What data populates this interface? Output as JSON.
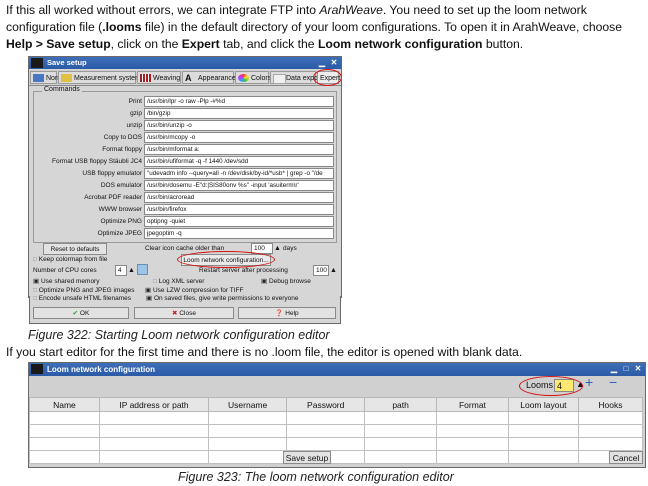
{
  "intro": {
    "p1_a": "If this all worked without errors, we can integrate FTP into ",
    "p1_app": "ArahWeave",
    "p1_b": ". You need to set up the loom network configuration file (",
    "p1_ext": ".looms",
    "p1_c": " file) in the default directory of your loom configurations. To open it in ArahWeave, choose ",
    "p1_menu": "Help > Save setup",
    "p1_d": ", click on the ",
    "p1_tab": "Expert",
    "p1_e": " tab, and click the ",
    "p1_btn": "Loom network configuration",
    "p1_f": " button."
  },
  "save_setup": {
    "title": "Save setup",
    "tabs": [
      "Normal",
      "Measurement system",
      "Weaving",
      "Appearance",
      "Colors",
      "Data export",
      "Expert"
    ],
    "commands_title": "Commands",
    "commands": [
      {
        "label": "Print",
        "value": "/usr/bin/lpr -o raw -Plp -#%d"
      },
      {
        "label": "gzip",
        "value": "/bin/gzip"
      },
      {
        "label": "unzip",
        "value": "/usr/bin/unzip -o"
      },
      {
        "label": "Copy to DOS",
        "value": "/usr/bin/mcopy -o"
      },
      {
        "label": "Format floppy",
        "value": "/usr/bin/mformat a:"
      },
      {
        "label": "Format USB floppy Stäubli JC4",
        "value": "/usr/bin/ufiformat -q -f 1440 /dev/sdd"
      },
      {
        "label": "USB floppy emulator",
        "value": "\"udevadm info --query=all -n /dev/disk/by-id/*usb* | grep -o \"/de"
      },
      {
        "label": "DOS emulator",
        "value": "/usr/bin/dosemu -E\"d:|SIS80onv %s\" -input 'asuiterm\\r'"
      },
      {
        "label": "Acrobat PDF reader",
        "value": "/usr/bin/acroread"
      },
      {
        "label": "WWW browser",
        "value": "/usr/bin/firefox"
      },
      {
        "label": "Optimize PNG",
        "value": "optipng -quiet"
      },
      {
        "label": "Optimize JPEG",
        "value": "jpegoptim -q"
      }
    ],
    "reset_defaults": "Reset to defaults",
    "clear_cache_label": "Clear icon cache older than",
    "clear_cache_value": "100",
    "days": "days",
    "keep_colormap": "Keep colormap from file",
    "loom_network_btn": "Loom network configuration...",
    "cpu_cores_label": "Number of CPU cores",
    "cpu_cores_value": "4",
    "restart_label": "Restart server after processing",
    "restart_value": "100",
    "use_shared_memory": "Use shared memory",
    "log_xml_server": "Log XML server",
    "debug_browse": "Debug browse",
    "optimize_png_jpeg": "Optimize PNG and JPEG images",
    "use_lzw": "Use LZW compression for TIFF",
    "encode_unsafe": "Encode unsafe HTML filenames",
    "on_saved_files": "On saved files, give write permissions to everyone",
    "ok": "OK",
    "close": "Close",
    "help": "Help"
  },
  "caption1": "Figure 322: Starting Loom network configuration editor",
  "mid_text": "If you start editor for the first time and there is no .loom file, the editor is opened with blank data.",
  "loom_editor": {
    "title": "Loom network configuration",
    "looms_label": "Looms",
    "looms_value": "4",
    "columns": [
      "Name",
      "IP address or path",
      "Username",
      "Password",
      "path",
      "Format",
      "Loom layout",
      "Hooks"
    ],
    "save_setup": "Save setup",
    "cancel": "Cancel"
  },
  "caption2": "Figure 323: The loom network configuration editor",
  "colors": {
    "accent_red": "#d21414",
    "title_blue": "#2b5aa6"
  }
}
